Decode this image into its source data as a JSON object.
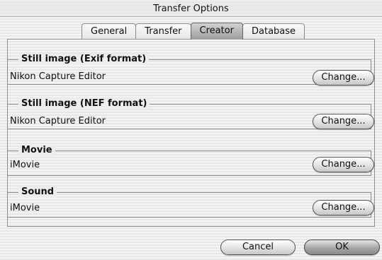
{
  "window": {
    "title": "Transfer Options"
  },
  "tabs": [
    {
      "label": "General"
    },
    {
      "label": "Transfer"
    },
    {
      "label": "Creator"
    },
    {
      "label": "Database"
    }
  ],
  "active_tab": "Creator",
  "groups": [
    {
      "title": "Still image (Exif format)",
      "value": "Nikon Capture Editor",
      "button": "Change..."
    },
    {
      "title": "Still image (NEF format)",
      "value": "Nikon Capture Editor",
      "button": "Change..."
    },
    {
      "title": "Movie",
      "value": "iMovie",
      "button": "Change..."
    },
    {
      "title": "Sound",
      "value": "iMovie",
      "button": "Change..."
    }
  ],
  "footer": {
    "cancel_label": "Cancel",
    "ok_label": "OK"
  }
}
